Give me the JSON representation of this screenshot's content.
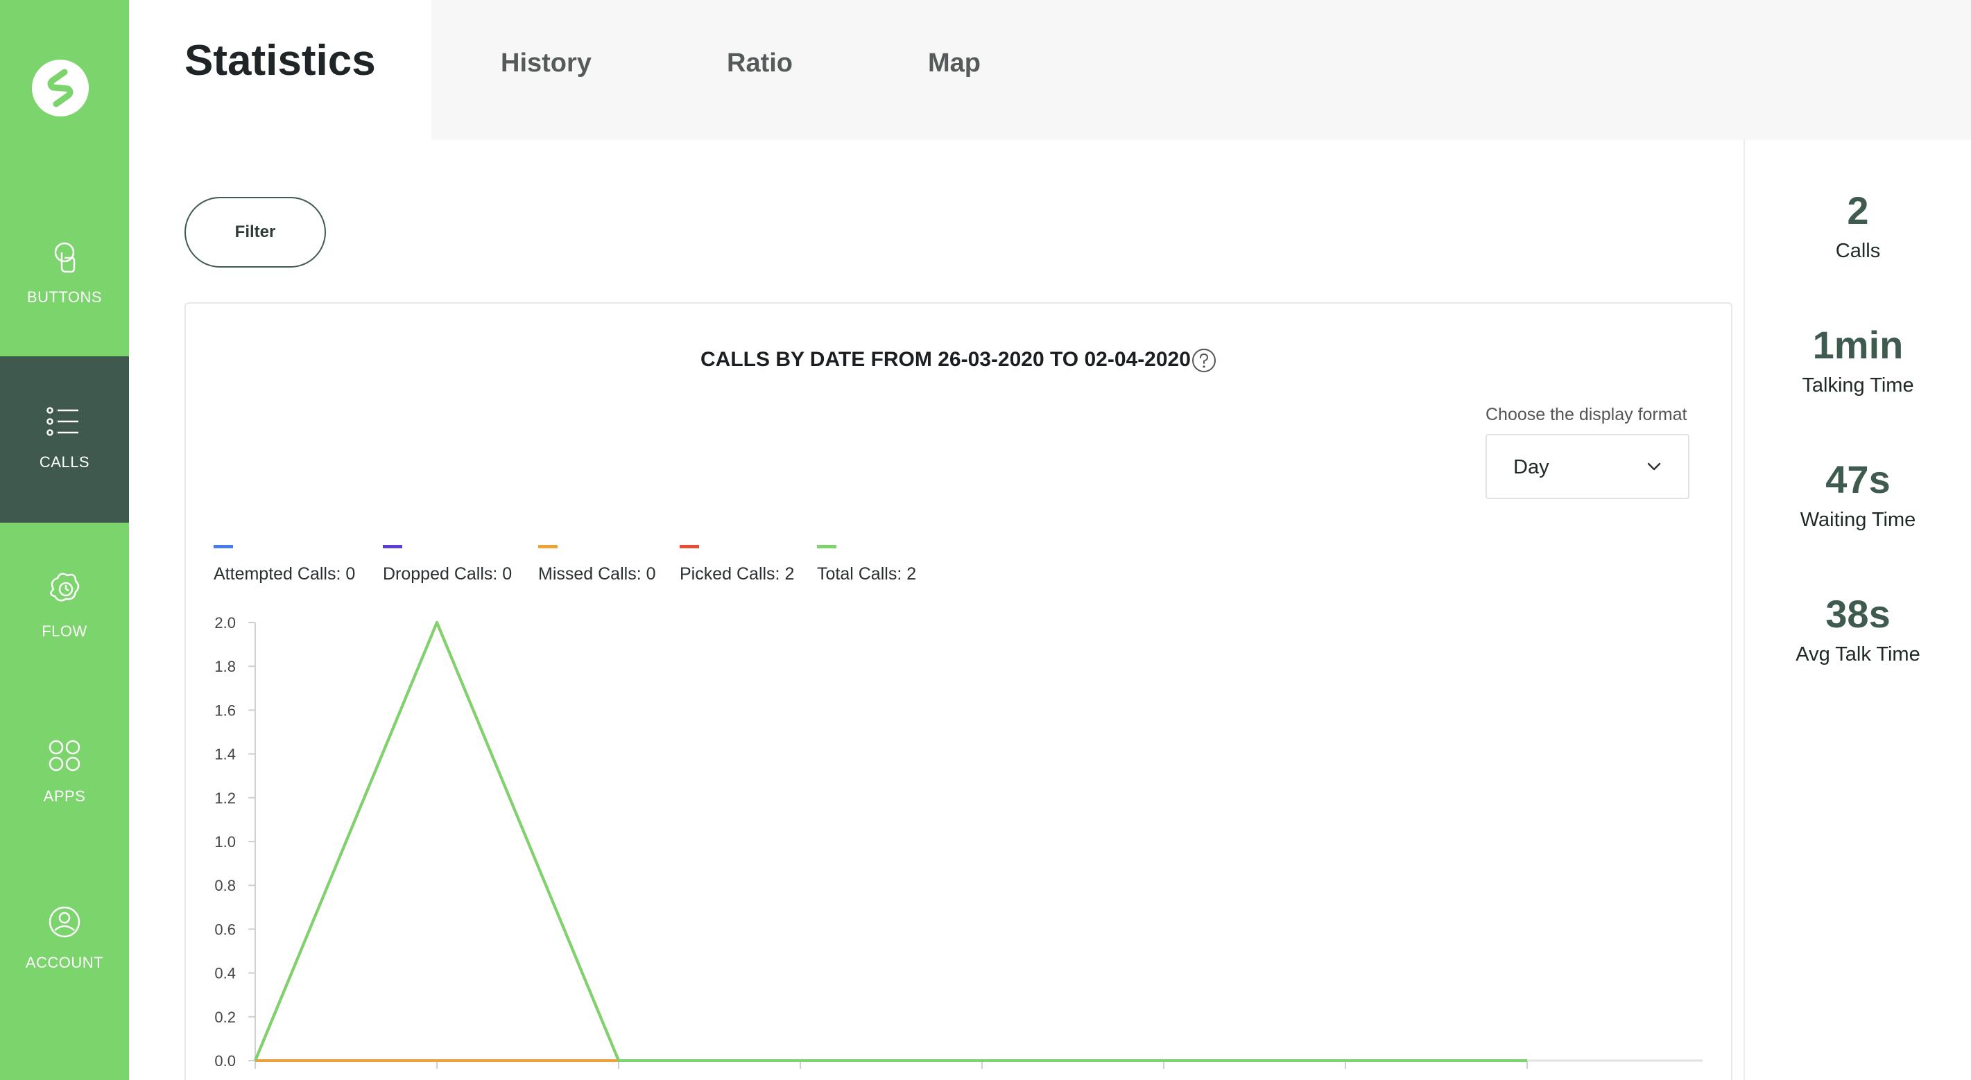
{
  "sidebar": {
    "items": [
      {
        "label": "BUTTONS",
        "icon": "touch-icon",
        "active": false
      },
      {
        "label": "CALLS",
        "icon": "list-icon",
        "active": true
      },
      {
        "label": "FLOW",
        "icon": "flow-icon",
        "active": false
      },
      {
        "label": "APPS",
        "icon": "apps-icon",
        "active": false
      },
      {
        "label": "ACCOUNT",
        "icon": "account-icon",
        "active": false
      }
    ]
  },
  "header": {
    "active_tab": "Statistics",
    "tabs": [
      "History",
      "Ratio",
      "Map"
    ]
  },
  "filter": {
    "label": "Filter"
  },
  "card": {
    "title": "CALLS BY DATE FROM 26-03-2020 TO 02-04-2020",
    "format_label": "Choose the display format",
    "format_value": "Day"
  },
  "stats": [
    {
      "value": "2",
      "label": "Calls"
    },
    {
      "value": "1min",
      "label": "Talking Time"
    },
    {
      "value": "47s",
      "label": "Waiting Time"
    },
    {
      "value": "38s",
      "label": "Avg Talk Time"
    }
  ],
  "colors": {
    "sidebar": "#7bd46c",
    "sidebar_active": "#40594f",
    "accent_dark": "#3f5a4e"
  },
  "chart_data": {
    "type": "line",
    "ylim": [
      0,
      2.0
    ],
    "y_ticks": [
      "0.0",
      "0.2",
      "0.4",
      "0.6",
      "0.8",
      "1.0",
      "1.2",
      "1.4",
      "1.6",
      "1.8",
      "2.0"
    ],
    "x": [
      0,
      1,
      2,
      3,
      4,
      5,
      6,
      7
    ],
    "legend": [
      {
        "label": "Attempted Calls: 0",
        "color": "#4a7be8"
      },
      {
        "label": "Dropped Calls: 0",
        "color": "#5b3fd6"
      },
      {
        "label": "Missed Calls: 0",
        "color": "#f0a23a"
      },
      {
        "label": "Picked Calls: 2",
        "color": "#ea4d35"
      },
      {
        "label": "Total Calls: 2",
        "color": "#7bd46c"
      }
    ],
    "series": [
      {
        "color": "#4a7be8",
        "values": [
          0,
          0,
          0,
          0,
          0,
          0,
          0,
          0
        ]
      },
      {
        "color": "#5b3fd6",
        "values": [
          0,
          0,
          0,
          0,
          0,
          0,
          0,
          0
        ]
      },
      {
        "color": "#f0a23a",
        "values": [
          0,
          0,
          0,
          0,
          0,
          0,
          0,
          0
        ]
      },
      {
        "color": "#ea4d35",
        "values": [
          0,
          2,
          0,
          0,
          0,
          0,
          0,
          0
        ]
      },
      {
        "color": "#7bd46c",
        "values": [
          0,
          2,
          0,
          0,
          0,
          0,
          0,
          0
        ]
      }
    ]
  }
}
